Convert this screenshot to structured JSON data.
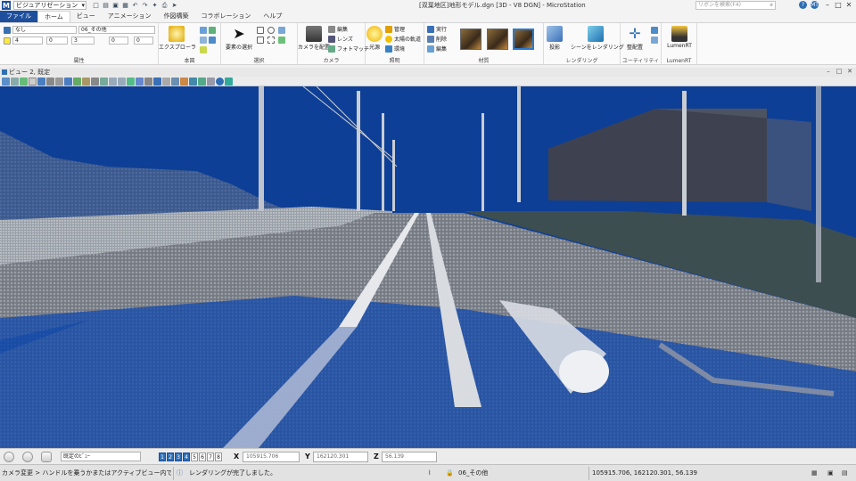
{
  "titlebar": {
    "workspace": "ビジュアリゼーション",
    "title": "[双葉地区]地形モデル.dgn [3D - V8 DGN] - MicroStation",
    "search_placeholder": "リボンを検索(F4)",
    "user_initials": "MT"
  },
  "tabs": [
    "ファイル",
    "ホーム",
    "ビュー",
    "アニメーション",
    "作図構築",
    "コラボレーション",
    "ヘルプ"
  ],
  "ribbon": {
    "attributes": {
      "label": "属性",
      "level": "なし",
      "level_name": "06_その他",
      "color": "4",
      "weight": "0",
      "style": "3",
      "transparency": "0",
      "priority": "0"
    },
    "basic": {
      "label": "本図",
      "explorer": "エクスプローラ"
    },
    "selection": {
      "label": "選択",
      "element_selection": "要素の選択"
    },
    "camera": {
      "label": "カメラ",
      "place_camera": "カメラを配置",
      "edit": "編集",
      "lens": "レンズ",
      "photo_match": "フォトマッチ"
    },
    "lighting": {
      "label": "照明",
      "light_source": "光源",
      "manage": "管理",
      "solar": "太陽の軌道",
      "environment": "環境"
    },
    "material": {
      "label": "材質",
      "apply": "実行",
      "delete": "削除",
      "edit": "編集"
    },
    "rendering": {
      "label": "レンダリング",
      "projection": "投影",
      "render_scene": "シーンをレンダリング"
    },
    "utility": {
      "label": "ユーティリティ",
      "arrange": "整配置"
    },
    "lumen": {
      "label": "LumenRT",
      "button": "LumenRT"
    }
  },
  "view_window": {
    "title": "ビュー 2, 既定"
  },
  "statusbar": {
    "view_select": "既定のﾋﾞｭｰ",
    "view_numbers": [
      "1",
      "2",
      "3",
      "4",
      "5",
      "6",
      "7",
      "8"
    ],
    "active_views": [
      1,
      2,
      3,
      4
    ],
    "x_label": "X",
    "x_value": "105915.706",
    "y_label": "Y",
    "y_value": "162120.301",
    "z_label": "Z",
    "z_value": "56.139",
    "prompt": "カメラ変更 > ハンドルを乗うかまたはアクティブビュー内でクリッ",
    "message": "レンダリングが完了しました。",
    "active_level": "06_その他",
    "coordinates": "105915.706, 162120.301, 56.139"
  },
  "colors": {
    "brand": "#1d4f9c",
    "viewport_bg": "#0e3f96"
  }
}
